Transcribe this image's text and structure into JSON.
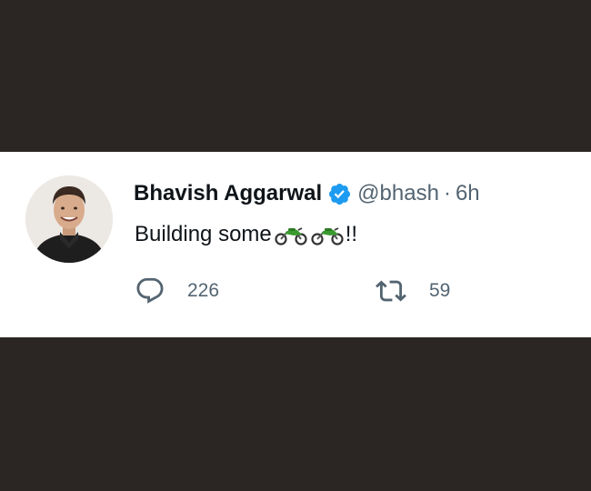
{
  "tweet": {
    "author": {
      "display_name": "Bhavish Aggarwal",
      "handle": "@bhash",
      "verified": true,
      "avatar_icon": "avatar-photo"
    },
    "separator": "·",
    "timestamp": "6h",
    "text": "Building some",
    "emoji": [
      "motorcycle-emoji",
      "motorcycle-emoji"
    ],
    "text_suffix": "!!",
    "stats": {
      "replies": "226",
      "retweets": "59"
    }
  },
  "colors": {
    "background": "#2b2624",
    "card": "#ffffff",
    "text_primary": "#0f1419",
    "text_secondary": "#536471",
    "verified_badge": "#1d9bf0",
    "emoji_green": "#3a9a2e"
  }
}
